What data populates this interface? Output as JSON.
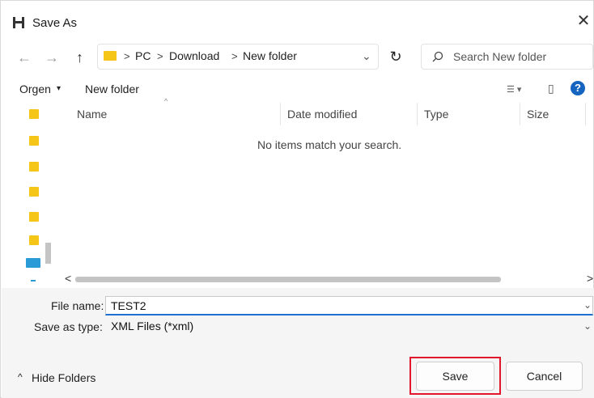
{
  "window": {
    "title": "Save As",
    "close_glyph": "✕"
  },
  "nav": {
    "back_glyph": "←",
    "forward_glyph": "→",
    "up_glyph": "↑",
    "breadcrumb": [
      "PC",
      "Download",
      "New folder"
    ],
    "separator": ">",
    "dropdown_glyph": "⌄",
    "refresh_glyph": "↻",
    "search_placeholder": "Search New folder"
  },
  "commands": {
    "organize": "Orgen",
    "organize_caret": "▾",
    "new_folder": "New folder",
    "view_glyph": "☰ ▾",
    "pane_glyph": "▯",
    "help_glyph": "?"
  },
  "columns": [
    "Name",
    "Date modified",
    "Type",
    "Size"
  ],
  "empty_message": "No items match your search.",
  "scroll": {
    "left_arrow": "<",
    "right_arrow": ">",
    "thumb_fraction": 0.8
  },
  "form": {
    "file_name_label": "File name:",
    "file_name_value": "TEST2",
    "save_type_label": "Save as type:",
    "save_type_value": "XML Files (*xml)"
  },
  "footer": {
    "hide_folders": "Hide Folders",
    "hide_caret": "^",
    "save_label": "Save",
    "cancel_label": "Cancel"
  },
  "colors": {
    "accent": "#1f6fd1",
    "highlight": "#e2172b",
    "folder": "#f5c518",
    "help": "#1565c0"
  }
}
